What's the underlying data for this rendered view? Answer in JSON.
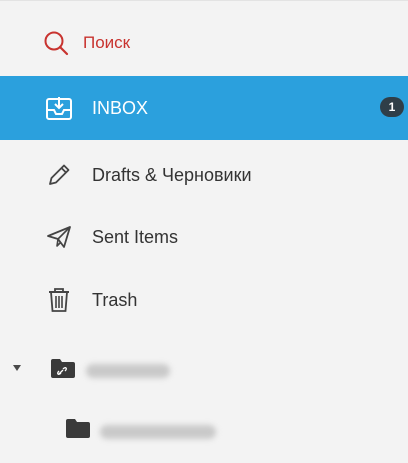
{
  "sidebar": {
    "search": {
      "label": "Поиск",
      "icon": "search-icon",
      "color": "#c8332f"
    },
    "inbox": {
      "label": "INBOX",
      "icon": "inbox-icon",
      "badge": "1",
      "active_bg": "#2ba0dd"
    },
    "drafts": {
      "label": "Drafts & Черновики",
      "icon": "pencil-icon"
    },
    "sent": {
      "label": "Sent Items",
      "icon": "paper-plane-icon"
    },
    "trash": {
      "label": "Trash",
      "icon": "trash-icon"
    },
    "folders": [
      {
        "icon": "shared-folder-icon",
        "expanded": true
      },
      {
        "icon": "folder-icon"
      }
    ]
  }
}
